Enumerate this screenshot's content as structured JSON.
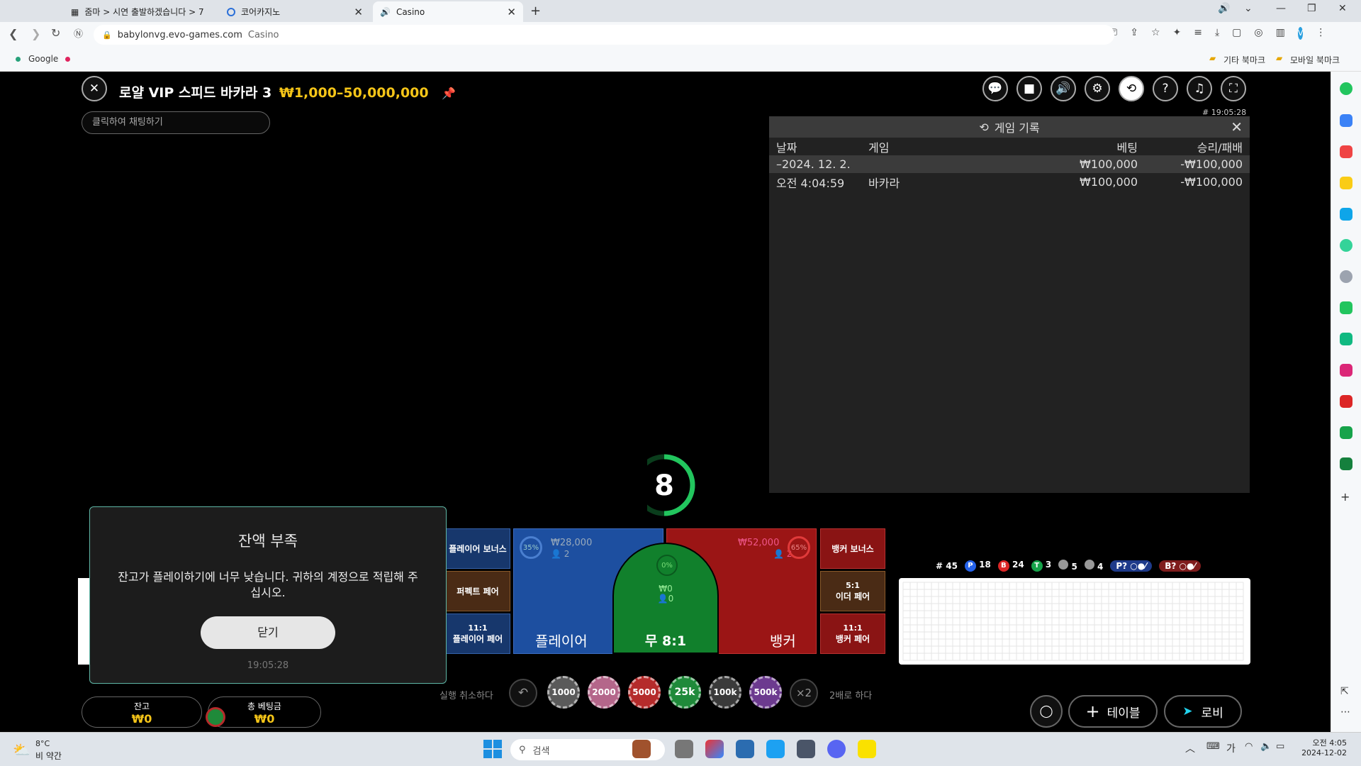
{
  "browser": {
    "tabs": [
      {
        "label": "줌마 > 시연 출발하겠습니다 > 7"
      },
      {
        "label": "코어카지노"
      },
      {
        "label": "Casino"
      }
    ],
    "url_domain": "babylonvg.evo-games.com",
    "url_title": "Casino",
    "bookmarks": {
      "google": "Google",
      "other": "기타 북마크",
      "mobile": "모바일 북마크"
    },
    "profile_letter": "V"
  },
  "game": {
    "title": "로얄 VIP 스피드 바카라 3",
    "limits": "₩1,000–50,000,000",
    "chat_placeholder": "클릭하여 채팅하기",
    "round_id": "# 19:05:28",
    "timer": "8"
  },
  "history": {
    "title": "게임 기록",
    "columns": {
      "date": "날짜",
      "game": "게임",
      "bet": "베팅",
      "result": "승리/패배"
    },
    "day_row": {
      "date": "–2024. 12. 2.",
      "bet": "₩100,000",
      "result": "-₩100,000"
    },
    "rows": [
      {
        "time": "오전 4:04:59",
        "game": "바카라",
        "bet": "₩100,000",
        "result": "-₩100,000"
      }
    ]
  },
  "table": {
    "player_bonus": "플레이어 보너스",
    "perfect_pair": "퍼펙트 페어",
    "player_pair_odds": "11:1",
    "player_pair": "플레이어 페어",
    "player": "플레이어",
    "player_pct": "35%",
    "player_amount": "₩28,000",
    "player_count": "2",
    "tie": "무 8:1",
    "tie_pct": "0%",
    "tie_amount": "₩0",
    "tie_count": "0",
    "banker": "뱅커",
    "banker_pct": "65%",
    "banker_amount": "₩52,000",
    "banker_count": "2",
    "banker_bonus": "뱅커 보너스",
    "either_pair_odds": "5:1",
    "either_pair": "이더 페어",
    "banker_pair_odds": "11:1",
    "banker_pair": "뱅커 페어"
  },
  "stats": {
    "round": "# 45",
    "p_letter": "P",
    "p": "18",
    "b_letter": "B",
    "b": "24",
    "t_letter": "T",
    "t": "3",
    "pp": "5",
    "bp": "4",
    "p_ask": "P?",
    "b_ask": "B?"
  },
  "modal": {
    "title": "잔액 부족",
    "message": "잔고가 플레이하기에 너무 낮습니다. 귀하의 계정으로 적립해 주십시오.",
    "button": "닫기",
    "time": "19:05:28"
  },
  "controls": {
    "undo": "실행 취소하다",
    "double": "2배로 하다",
    "x2": "×2",
    "chips": [
      "1000",
      "2000",
      "5000",
      "25k",
      "100k",
      "500k"
    ],
    "table_btn": "테이블",
    "lobby_btn": "로비"
  },
  "balance": {
    "label": "잔고",
    "value": "₩0",
    "total_label": "총 베팅금",
    "total_value": "₩0"
  },
  "taskbar": {
    "weather_temp": "8°C",
    "weather_desc": "비 약간",
    "search": "검색",
    "ime": "가",
    "time": "오전 4:05",
    "date": "2024-12-02"
  },
  "colors": {
    "gold": "#f5c518",
    "player_blue": "#1d4fa0",
    "banker_red": "#9b1515",
    "tie_green": "#11802c",
    "timer_green": "#22c55e"
  }
}
